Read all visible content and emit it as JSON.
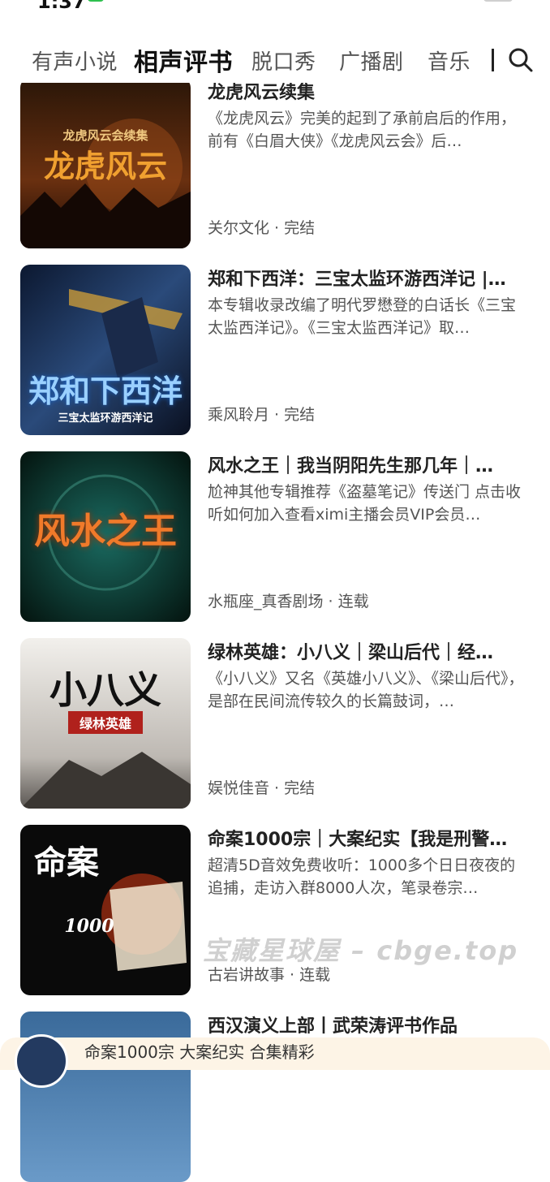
{
  "status_bar": {
    "time": "1:37"
  },
  "tabs": [
    {
      "label": "有声小说",
      "active": false
    },
    {
      "label": "相声评书",
      "active": true
    },
    {
      "label": "脱口秀",
      "active": false
    },
    {
      "label": "广播剧",
      "active": false
    },
    {
      "label": "音乐",
      "active": false
    }
  ],
  "items": [
    {
      "title": "龙虎风云续集",
      "description": "《龙虎风云》完美的起到了承前启后的作用，前有《白眉大侠》《龙虎风云会》后…",
      "meta": "关尔文化 · 完结",
      "cover": {
        "text": "龙虎风云",
        "subtext": "龙虎风云会续集",
        "colors": [
          "#2a1608",
          "#6a3010",
          "#e08a2a"
        ]
      }
    },
    {
      "title": "郑和下西洋：三宝太监环游西洋记 |…",
      "description": "本专辑收录改编了明代罗懋登的白话长《三宝太监西洋记》。《三宝太监西洋记》取…",
      "meta": "乘风聆月 · 完结",
      "cover": {
        "text": "郑和下西洋",
        "subtext": "三宝太监环游西洋记",
        "colors": [
          "#0c1830",
          "#2a4a7a",
          "#4aa0e8"
        ]
      }
    },
    {
      "title": "风水之王｜我当阴阳先生那几年｜…",
      "description": "尬神其他专辑推荐《盗墓笔记》传送门 点击收听如何加入查看ximi主播会员VIP会员…",
      "meta": "水瓶座_真香剧场 · 连载",
      "cover": {
        "text": "风水之王",
        "subtext": "",
        "colors": [
          "#06201e",
          "#0e4a44",
          "#e8621a"
        ]
      }
    },
    {
      "title": "绿林英雄：小八义｜梁山后代｜经…",
      "description": "《小八义》又名《英雄小八义》、《梁山后代》，是部在民间流传较久的长篇鼓词，…",
      "meta": "娱悦佳音 · 完结",
      "cover": {
        "text": "小八义",
        "subtext": "绿林英雄",
        "colors": [
          "#e9e6e2",
          "#9a9590",
          "#b0211c"
        ]
      }
    },
    {
      "title": "命案1000宗｜大案纪实【我是刑警…",
      "description": "超清5D音效免费收听：1000多个日日夜夜的追捕，走访入群8000人次，笔录卷宗…",
      "meta": "古岩讲故事 · 连载",
      "cover": {
        "text": "命案",
        "subtext": "1000",
        "colors": [
          "#0a0a0a",
          "#3a1008",
          "#d83a14"
        ]
      }
    },
    {
      "title": "西汉演义上部丨武荣涛评书作品",
      "description": "",
      "meta": "",
      "cover": {
        "text": "",
        "subtext": "",
        "colors": [
          "#3a6a9a",
          "#6a9ac8",
          "#c8a86a"
        ]
      }
    }
  ],
  "watermark": "宝藏星球屋 – cbge.top",
  "mini_player": {
    "text": "命案1000宗 大案纪实 合集精彩"
  }
}
